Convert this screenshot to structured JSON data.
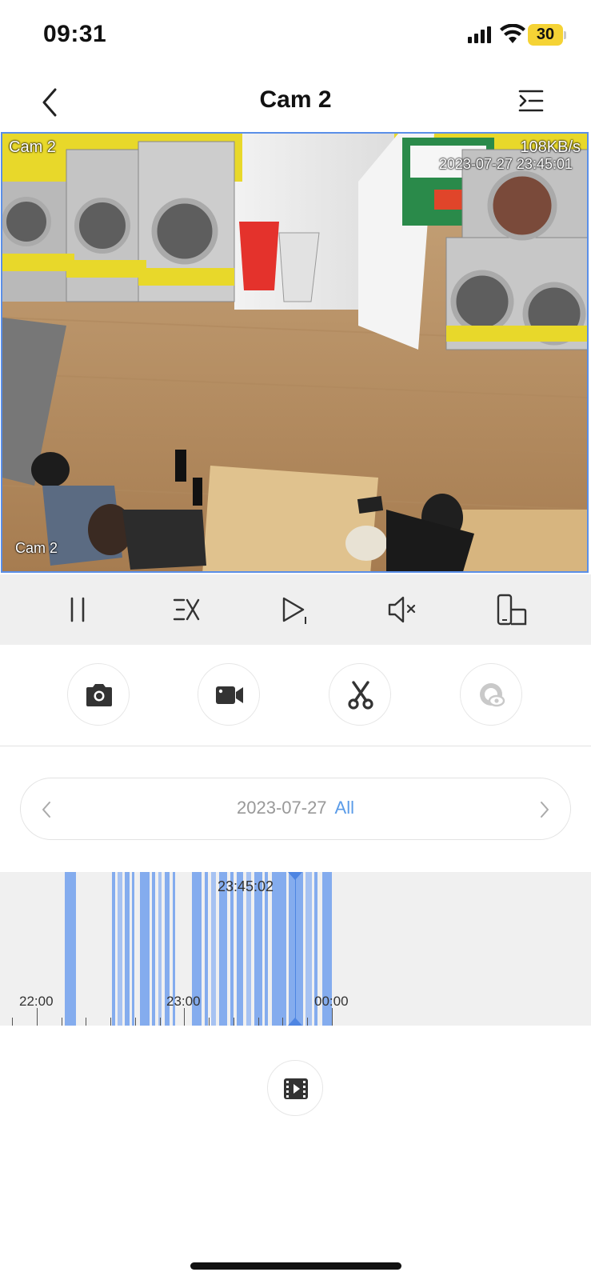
{
  "status_bar": {
    "time": "09:31",
    "battery": "30",
    "battery_color": "#f5d335"
  },
  "header": {
    "title": "Cam 2"
  },
  "video": {
    "overlay_channel_top": "Cam 2",
    "overlay_bitrate": "108KB/s",
    "overlay_timestamp": "2023-07-27 23:45:01",
    "overlay_channel_bottom": "Cam 2",
    "border_color": "#5a8fe8"
  },
  "controls": [
    {
      "name": "pause-icon"
    },
    {
      "name": "speed-icon"
    },
    {
      "name": "step-play-icon"
    },
    {
      "name": "mute-icon"
    },
    {
      "name": "fullscreen-rotate-icon"
    }
  ],
  "tools": [
    {
      "name": "snapshot-camera-icon"
    },
    {
      "name": "record-video-icon"
    },
    {
      "name": "clip-scissors-icon"
    },
    {
      "name": "watch-eye-icon",
      "disabled": true
    }
  ],
  "date_selector": {
    "date": "2023-07-27",
    "filter": "All"
  },
  "timeline": {
    "cursor_time": "23:45:02",
    "hour_labels": [
      "22:00",
      "23:00",
      "00:00"
    ],
    "accent": "#84acee"
  },
  "footer": {
    "icon": "film-list-icon"
  }
}
